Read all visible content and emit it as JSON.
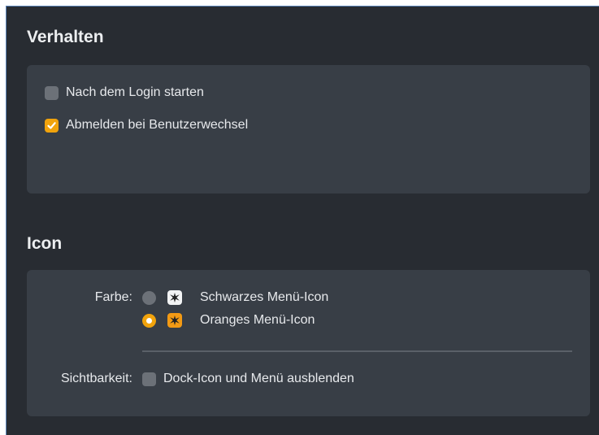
{
  "sections": {
    "behavior": {
      "title": "Verhalten",
      "options": [
        {
          "label": "Nach dem Login starten",
          "checked": false
        },
        {
          "label": "Abmelden bei Benutzerwechsel",
          "checked": true
        }
      ]
    },
    "icon": {
      "title": "Icon",
      "color_label": "Farbe:",
      "color_options": [
        {
          "label": "Schwarzes Menü-Icon",
          "selected": false,
          "icon": "star-burst-icon",
          "icon_style": "white"
        },
        {
          "label": "Oranges Menü-Icon",
          "selected": true,
          "icon": "star-burst-icon",
          "icon_style": "orange"
        }
      ],
      "visibility_label": "Sichtbarkeit:",
      "visibility_option": {
        "label": "Dock-Icon und Menü ausblenden",
        "checked": false
      }
    }
  },
  "colors": {
    "background": "#282c32",
    "panel": "#383e46",
    "accent": "#f1a30c",
    "control_off": "#6c7178"
  }
}
